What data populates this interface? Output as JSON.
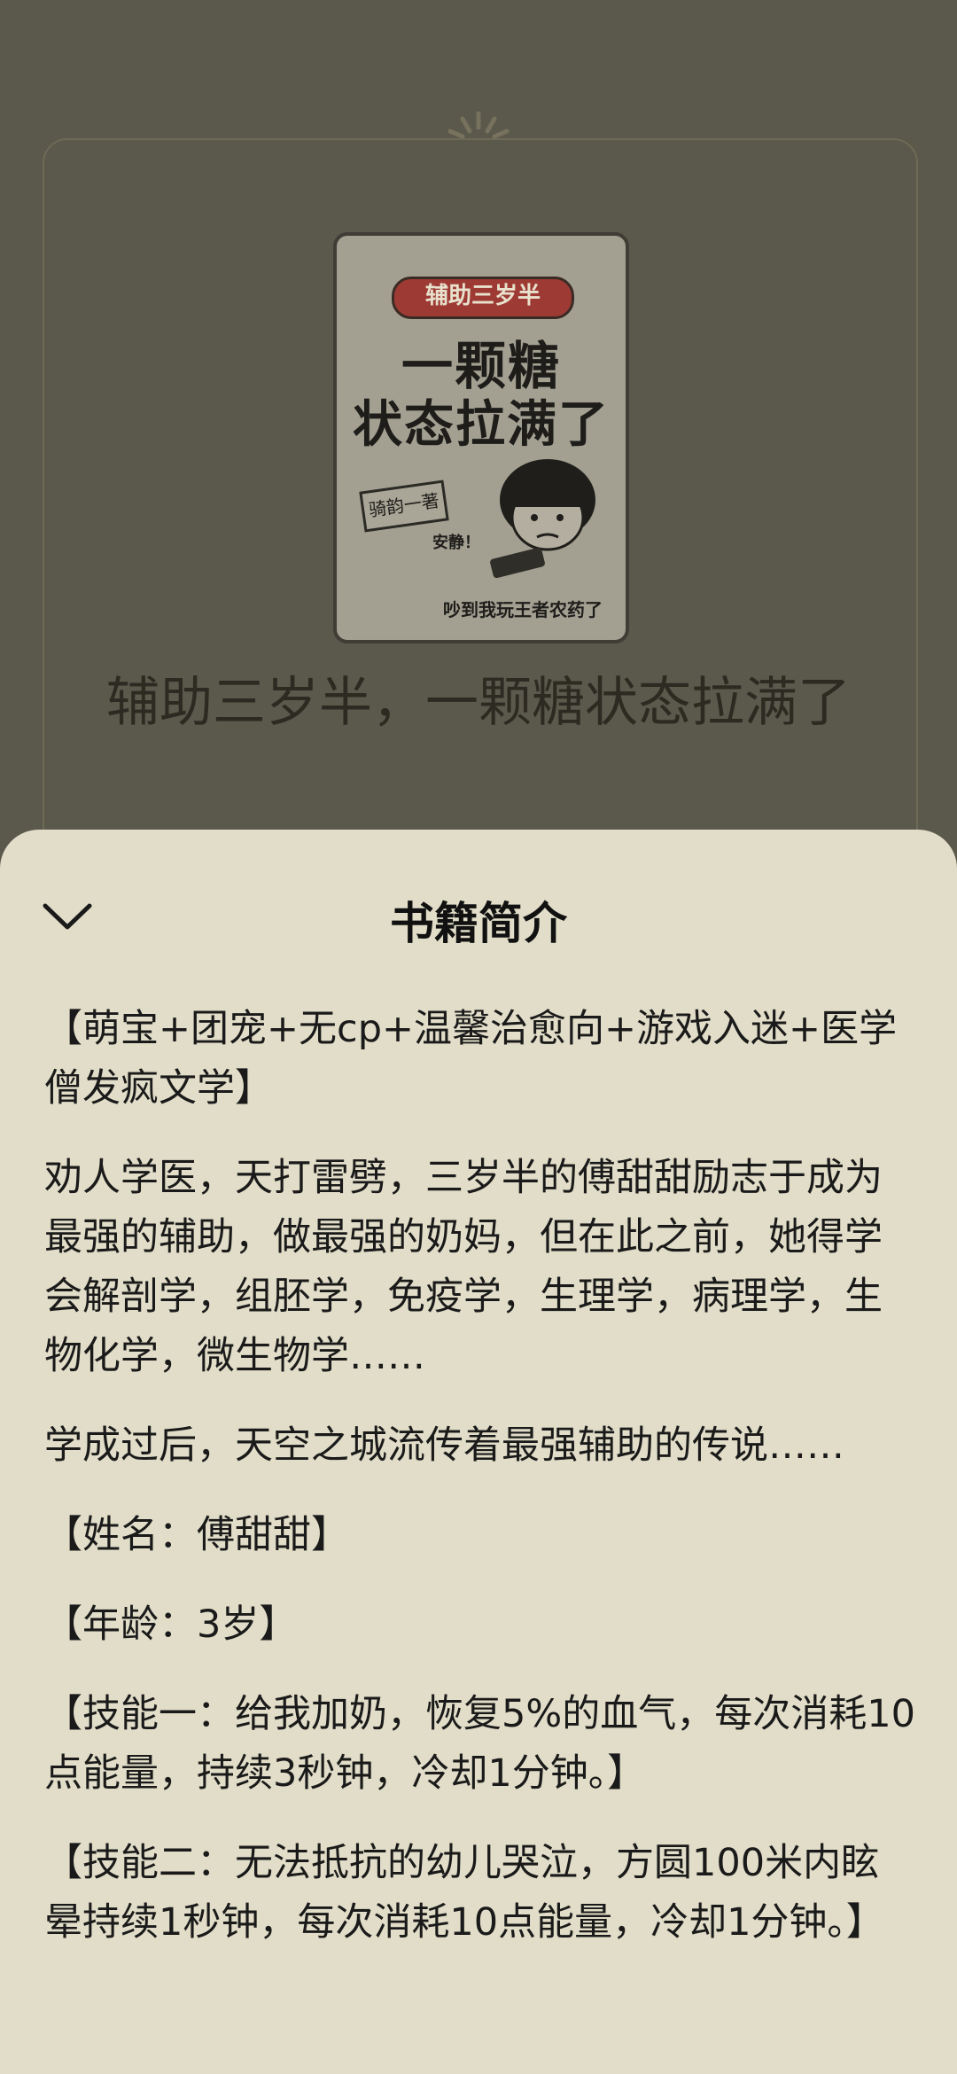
{
  "background": {
    "cover": {
      "tag": "辅助三岁半",
      "line1": "一颗糖",
      "line2": "状态拉满了",
      "author": "骑韵一著",
      "speech": "安静！",
      "caption": "吵到我玩王者农药了"
    },
    "book_title": "辅助三岁半，一颗糖状态拉满了"
  },
  "sheet": {
    "title": "书籍简介",
    "collapse_icon": "chevron-down-icon",
    "paragraphs": [
      "【萌宝+团宠+无cp+温馨治愈向+游戏入迷+医学僧发疯文学】",
      "劝人学医，天打雷劈，三岁半的傅甜甜励志于成为最强的辅助，做最强的奶妈，但在此之前，她得学会解剖学，组胚学，免疫学，生理学，病理学，生物化学，微生物学……",
      "学成过后，天空之城流传着最强辅助的传说……",
      "【姓名：傅甜甜】",
      "【年龄：3岁】",
      "【技能一：给我加奶，恢复5%的血气，每次消耗10点能量，持续3秒钟，冷却1分钟。】",
      "【技能二：无法抵抗的幼儿哭泣，方圆100米内眩晕持续1秒钟，每次消耗10点能量，冷却1分钟。】"
    ]
  },
  "colors": {
    "dim_background": "#5b584c",
    "sheet_background": "#e1ddc8",
    "text": "#1a1a1a"
  }
}
